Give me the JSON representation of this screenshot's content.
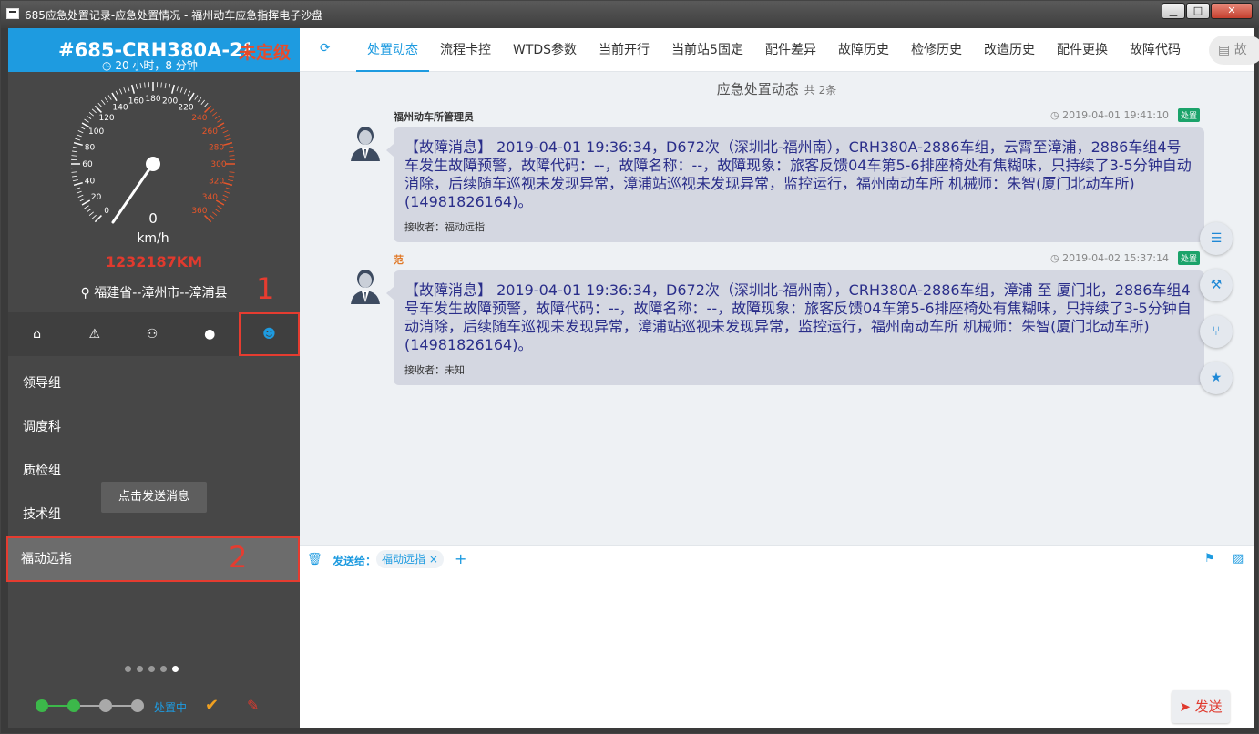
{
  "window": {
    "title": "685应急处置记录-应急处置情况 - 福州动车应急指挥电子沙盘",
    "minimize": "▁",
    "maximize": "□",
    "close": "✕"
  },
  "vehicle": {
    "id": "#685-CRH380A-2886",
    "severity": "未定级",
    "duration": "20 小时，8 分钟",
    "speed_unit": "km/h",
    "speed_value": "0",
    "speed": 0,
    "speed_max": 360,
    "gauge_ticks": [
      "0",
      "20",
      "40",
      "60",
      "80",
      "100",
      "120",
      "140",
      "160",
      "180",
      "200",
      "220",
      "240",
      "260",
      "280",
      "300",
      "320",
      "340",
      "360"
    ],
    "distance": "1232187KM",
    "location": "福建省--漳州市--漳浦县"
  },
  "annotations": {
    "one": "1",
    "two": "2"
  },
  "sidebar_tabs": [
    {
      "name": "home",
      "icon": "⌂"
    },
    {
      "name": "warning",
      "icon": "⚠"
    },
    {
      "name": "org",
      "icon": "⚇"
    },
    {
      "name": "user",
      "icon": "●"
    },
    {
      "name": "group",
      "icon": "☻",
      "active": true
    }
  ],
  "groups": [
    "领导组",
    "调度科",
    "质检组",
    "技术组",
    "福动远指"
  ],
  "selected_group": "福动远指",
  "tooltip": "点击发送消息",
  "pager": {
    "count": 5,
    "active": 4
  },
  "progress": {
    "label": "处置中",
    "completed_steps": 2,
    "total_steps": 4
  },
  "tabs": [
    "处置动态",
    "流程卡控",
    "WTDS参数",
    "当前开行",
    "当前站5固定",
    "配件差异",
    "故障历史",
    "检修历史",
    "改造历史",
    "配件更换",
    "故障代码"
  ],
  "search": {
    "label": "故"
  },
  "feed": {
    "title": "应急处置动态",
    "count": "共 2条",
    "messages": [
      {
        "sender": "福州动车所管理员",
        "time": "2019-04-01 19:41:10",
        "badge": "处置",
        "body": "【故障消息】 2019-04-01 19:36:34，D672次（深圳北-福州南），CRH380A-2886车组，云霄至漳浦，2886车组4号车发生故障预警，故障代码：--，故障名称：--，故障现象：旅客反馈04车第5-6排座椅处有焦糊味，只持续了3-5分钟自动消除，后续随车巡视未发现异常，漳浦站巡视未发现异常，监控运行，福州南动车所 机械师：朱智(厦门北动车所)(14981826164)。",
        "receiver": "接收者：福动远指"
      },
      {
        "sender": "范",
        "time": "2019-04-02 15:37:14",
        "badge": "处置",
        "body": "【故障消息】 2019-04-01 19:36:34，D672次（深圳北-福州南），CRH380A-2886车组，漳浦 至 厦门北，2886车组4号车发生故障预警，故障代码：--，故障名称：--，故障现象：旅客反馈04车第5-6排座椅处有焦糊味，只持续了3-5分钟自动消除，后续随车巡视未发现异常，漳浦站巡视未发现异常，监控运行，福州南动车所 机械师：朱智(厦门北动车所)(14981826164)。",
        "receiver": "接收者：未知"
      }
    ]
  },
  "fabs": [
    "list-icon",
    "tools-icon",
    "branch-icon",
    "star-icon"
  ],
  "composer": {
    "send_to_label": "发送给：",
    "recipient": "福动远指",
    "remove": "×",
    "add": "+",
    "send_button": "发送"
  },
  "colors": {
    "accent": "#1e9be0",
    "sidebar": "#474747",
    "alert": "#e53c30",
    "bubble": "#d4d7e1",
    "bubble_text": "#2a2e8a",
    "badge": "#1ba36a",
    "progress_done": "#3cb84a",
    "progress_todo": "#a9a9a9"
  }
}
